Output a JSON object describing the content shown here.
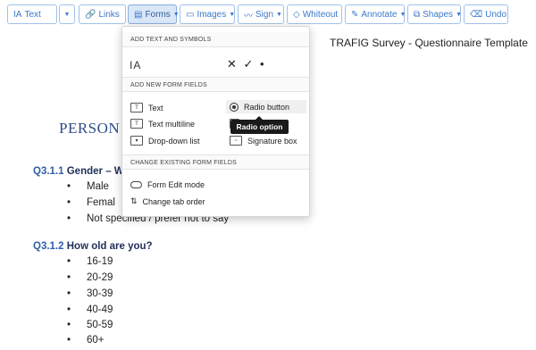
{
  "toolbar": {
    "text": "Text",
    "links": "Links",
    "forms": "Forms",
    "images": "Images",
    "sign": "Sign",
    "whiteout": "Whiteout",
    "annotate": "Annotate",
    "shapes": "Shapes",
    "undo": "Undo"
  },
  "menu": {
    "sec_text_symbols": "ADD TEXT AND SYMBOLS",
    "symbol_ia": "IA",
    "symbol_marks": "✕ ✓ •",
    "sec_form_fields": "ADD NEW FORM FIELDS",
    "text": "Text",
    "text_multiline": "Text multiline",
    "dropdown_list": "Drop-down list",
    "radio_button": "Radio button",
    "signature_box": "Signature box",
    "sec_change": "CHANGE EXISTING FORM FIELDS",
    "form_edit_mode": "Form Edit mode",
    "change_tab_order": "Change tab order",
    "tooltip": "Radio option"
  },
  "document": {
    "header": "TRAFIG Survey - Questionnaire Template",
    "section_title": "PERSON",
    "q1": {
      "num": "Q3.1.1",
      "text": "Gender – W"
    },
    "q1_options": [
      "Male",
      "Femal",
      "Not specified / prefer not to say"
    ],
    "q2": {
      "num": "Q3.1.2",
      "text": "How old are you?"
    },
    "q2_options": [
      "16-19",
      "20-29",
      "30-39",
      "40-49",
      "50-59",
      "60+"
    ]
  }
}
